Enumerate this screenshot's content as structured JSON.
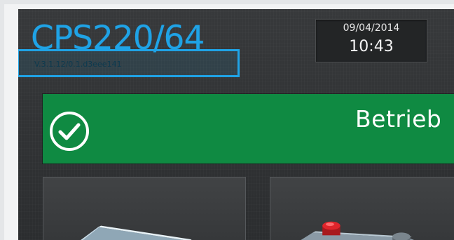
{
  "header": {
    "device_name": "CPS220/64",
    "version": "V.3.1.12/0.1.d3eee141",
    "date": "09/04/2014",
    "time": "10:43"
  },
  "status": {
    "label": "Betrieb",
    "icon": "check-circle-icon",
    "color": "#0f8a42"
  },
  "tiles": [
    {
      "icon": "battery-icon"
    },
    {
      "icon": "battery-icon"
    }
  ],
  "colors": {
    "accent": "#1fa3e6",
    "status_ok": "#0f8a42",
    "background": "#2f3133"
  }
}
